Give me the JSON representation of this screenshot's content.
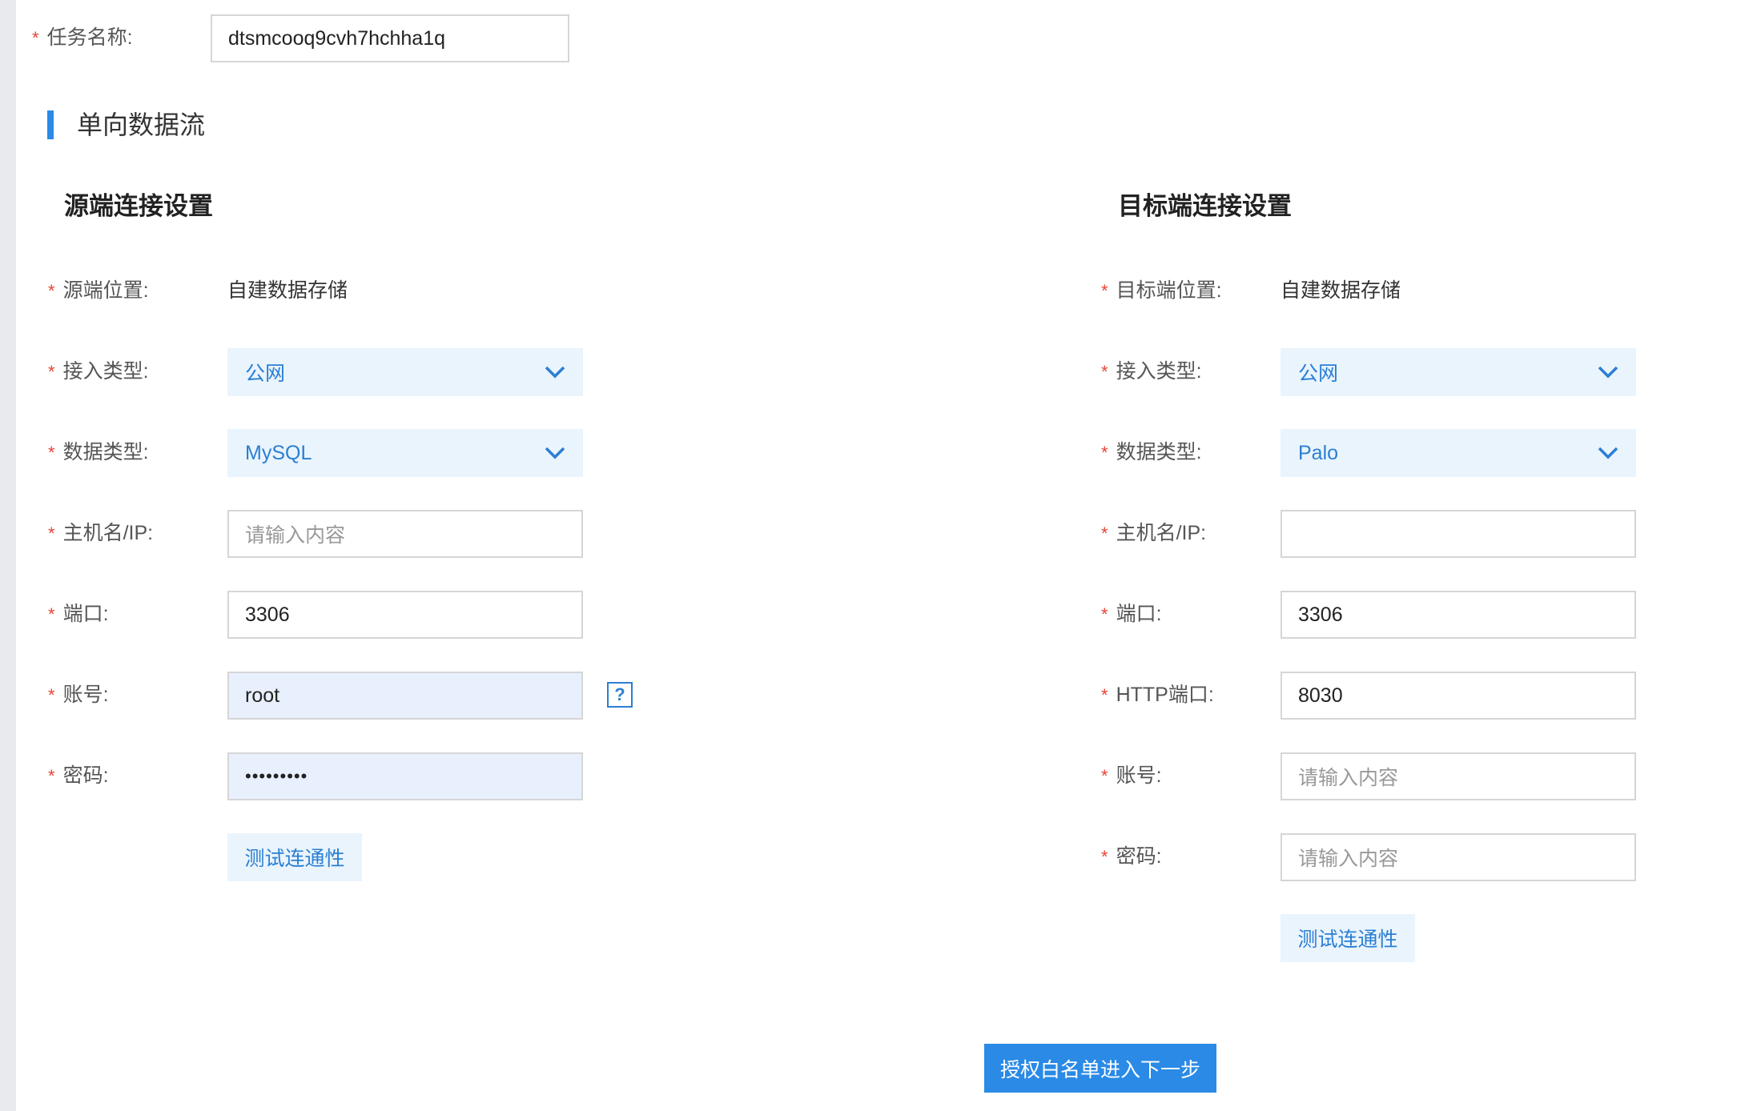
{
  "task": {
    "label": "任务名称:",
    "value": "dtsmcooq9cvh7hchha1q"
  },
  "section": {
    "title": "单向数据流"
  },
  "source": {
    "title": "源端连接设置",
    "location_label": "源端位置:",
    "location_value": "自建数据存储",
    "access_label": "接入类型:",
    "access_value": "公网",
    "dbtype_label": "数据类型:",
    "dbtype_value": "MySQL",
    "host_label": "主机名/IP:",
    "host_placeholder": "请输入内容",
    "port_label": "端口:",
    "port_value": "3306",
    "account_label": "账号:",
    "account_value": "root",
    "help_icon": "?",
    "password_label": "密码:",
    "password_value": "•••••••••",
    "test_button": "测试连通性"
  },
  "target": {
    "title": "目标端连接设置",
    "location_label": "目标端位置:",
    "location_value": "自建数据存储",
    "access_label": "接入类型:",
    "access_value": "公网",
    "dbtype_label": "数据类型:",
    "dbtype_value": "Palo",
    "host_label": "主机名/IP:",
    "host_value": "",
    "port_label": "端口:",
    "port_value": "3306",
    "http_port_label": "HTTP端口:",
    "http_port_value": "8030",
    "account_label": "账号:",
    "account_placeholder": "请输入内容",
    "password_label": "密码:",
    "password_placeholder": "请输入内容",
    "test_button": "测试连通性"
  },
  "footer": {
    "next_button": "授权白名单进入下一步"
  },
  "required_mark": "*",
  "colors": {
    "accent": "#2a8ae6",
    "required": "#ea4335",
    "select_bg": "#eaf4fd"
  }
}
